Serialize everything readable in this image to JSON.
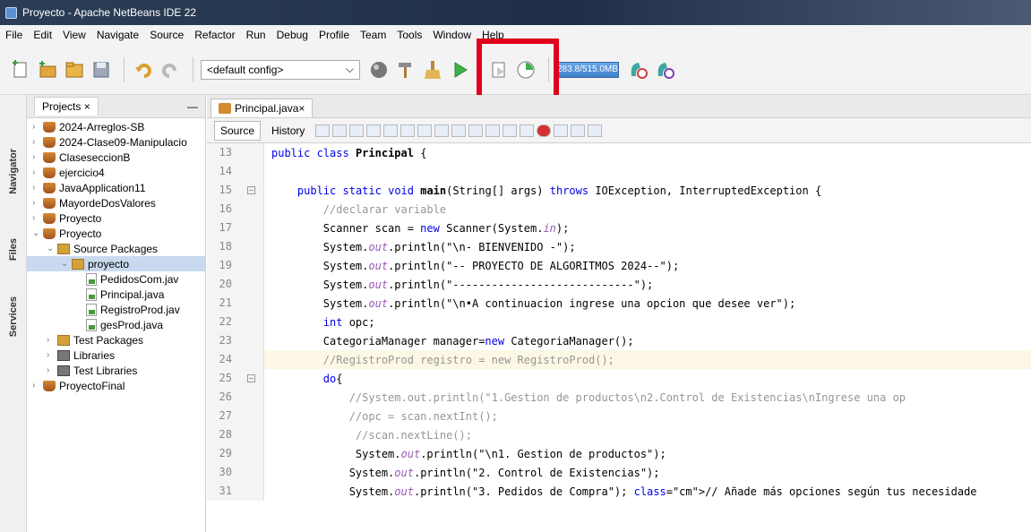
{
  "window": {
    "title": "Proyecto - Apache NetBeans IDE 22"
  },
  "menu": [
    "File",
    "Edit",
    "View",
    "Navigate",
    "Source",
    "Refactor",
    "Run",
    "Debug",
    "Profile",
    "Team",
    "Tools",
    "Window",
    "Help"
  ],
  "toolbar": {
    "config": "<default config>",
    "memory": "283.8/515.0MB"
  },
  "left_tabs": [
    "Navigator",
    "Files",
    "Services"
  ],
  "projects_panel": {
    "tab": "Projects",
    "items": [
      {
        "label": "2024-Arreglos-SB",
        "level": 0,
        "icon": "project-cup-icon"
      },
      {
        "label": "2024-Clase09-Manipulacio",
        "level": 0,
        "icon": "project-cup-icon"
      },
      {
        "label": "ClaseseccionB",
        "level": 0,
        "icon": "project-cup-icon"
      },
      {
        "label": "ejercicio4",
        "level": 0,
        "icon": "project-cup-icon"
      },
      {
        "label": "JavaApplication11",
        "level": 0,
        "icon": "project-cup-icon"
      },
      {
        "label": "MayordeDosValores",
        "level": 0,
        "icon": "project-cup-icon"
      },
      {
        "label": "Proyecto",
        "level": 0,
        "icon": "project-cup-icon"
      },
      {
        "label": "Proyecto",
        "level": 0,
        "icon": "project-cup-icon"
      },
      {
        "label": "Source Packages",
        "level": 1,
        "icon": "package-icon"
      },
      {
        "label": "proyecto",
        "level": 2,
        "icon": "package-icon"
      },
      {
        "label": "PedidosCom.jav",
        "level": 3,
        "icon": "java-file-icon"
      },
      {
        "label": "Principal.java",
        "level": 3,
        "icon": "java-file-icon"
      },
      {
        "label": "RegistroProd.jav",
        "level": 3,
        "icon": "java-file-icon"
      },
      {
        "label": "gesProd.java",
        "level": 3,
        "icon": "java-file-icon"
      },
      {
        "label": "Test Packages",
        "level": 1,
        "icon": "package-icon"
      },
      {
        "label": "Libraries",
        "level": 1,
        "icon": "library-icon"
      },
      {
        "label": "Test Libraries",
        "level": 1,
        "icon": "library-icon"
      },
      {
        "label": "ProyectoFinal",
        "level": 0,
        "icon": "project-cup-icon"
      }
    ]
  },
  "editor": {
    "tab": "Principal.java",
    "source_label": "Source",
    "history_label": "History",
    "lines": [
      {
        "n": "13",
        "text": "public class Principal {"
      },
      {
        "n": "14",
        "text": ""
      },
      {
        "n": "15",
        "text": "    public static void main(String[] args) throws IOException, InterruptedException {"
      },
      {
        "n": "16",
        "text": "        //declarar variable"
      },
      {
        "n": "17",
        "text": "        Scanner scan = new Scanner(System.in);"
      },
      {
        "n": "18",
        "text": "        System.out.println(\"\\n- BIENVENIDO -\");"
      },
      {
        "n": "19",
        "text": "        System.out.println(\"-- PROYECTO DE ALGORITMOS 2024--\");"
      },
      {
        "n": "20",
        "text": "        System.out.println(\"----------------------------\");"
      },
      {
        "n": "21",
        "text": "        System.out.println(\"\\n•A continuacion ingrese una opcion que desee ver\");"
      },
      {
        "n": "22",
        "text": "        int opc;"
      },
      {
        "n": "23",
        "text": "        CategoriaManager manager=new CategoriaManager();"
      },
      {
        "n": "24",
        "text": "        //RegistroProd registro = new RegistroProd();"
      },
      {
        "n": "25",
        "text": "        do{"
      },
      {
        "n": "26",
        "text": "            //System.out.println(\"1.Gestion de productos\\n2.Control de Existencias\\nIngrese una op"
      },
      {
        "n": "27",
        "text": "            //opc = scan.nextInt();"
      },
      {
        "n": "28",
        "text": "             //scan.nextLine();"
      },
      {
        "n": "29",
        "text": "             System.out.println(\"\\n1. Gestion de productos\");"
      },
      {
        "n": "30",
        "text": "            System.out.println(\"2. Control de Existencias\");"
      },
      {
        "n": "31",
        "text": "            System.out.println(\"3. Pedidos de Compra\"); // Añade más opciones según tus necesidade"
      }
    ]
  }
}
